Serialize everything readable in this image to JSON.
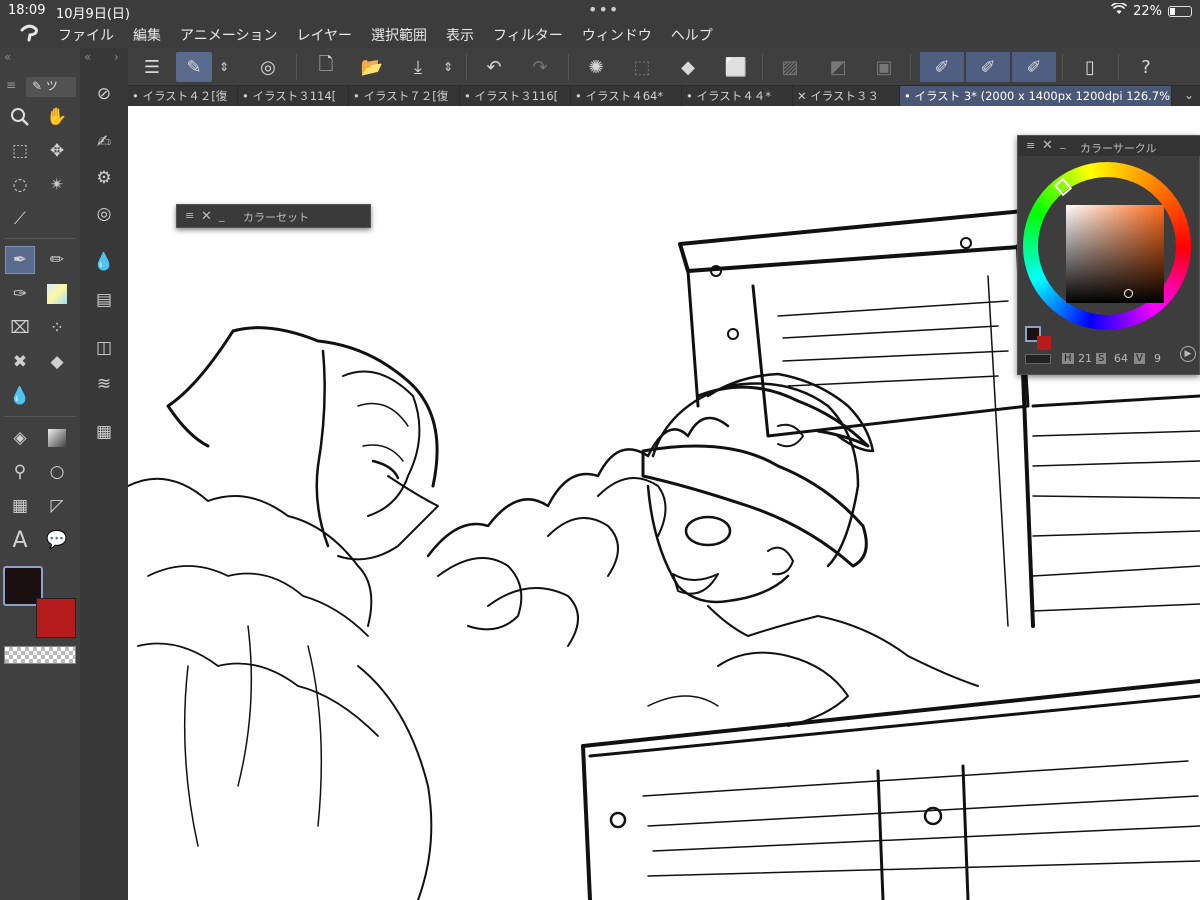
{
  "status": {
    "time": "18:09",
    "date": "10月9日(日)",
    "battery": "22%",
    "dots": "•••"
  },
  "menu": [
    "ファイル",
    "編集",
    "アニメーション",
    "レイヤー",
    "選択範囲",
    "表示",
    "フィルター",
    "ウィンドウ",
    "ヘルプ"
  ],
  "tabs": [
    {
      "label": "• イラスト４２[復"
    },
    {
      "label": "• イラスト３114["
    },
    {
      "label": "• イラスト７２[復"
    },
    {
      "label": "• イラスト３116["
    },
    {
      "label": "• イラスト４64*"
    },
    {
      "label": "• イラスト４４*"
    },
    {
      "label": "✕ イラスト３３"
    },
    {
      "label": "• イラスト 3* (2000 x 1400px 1200dpi 126.7%)"
    }
  ],
  "panels": {
    "colorset_title": "カラーセット",
    "colorcircle_title": "カラーサークル",
    "hsv": {
      "h_label": "H",
      "h": "21",
      "s_label": "S",
      "s": "64",
      "v_label": "V",
      "v": "9"
    }
  },
  "left_panel_tab": "ツ",
  "colors": {
    "main": "#1a1010",
    "sub": "#b71c1c",
    "accent": "#5a6a8c"
  }
}
